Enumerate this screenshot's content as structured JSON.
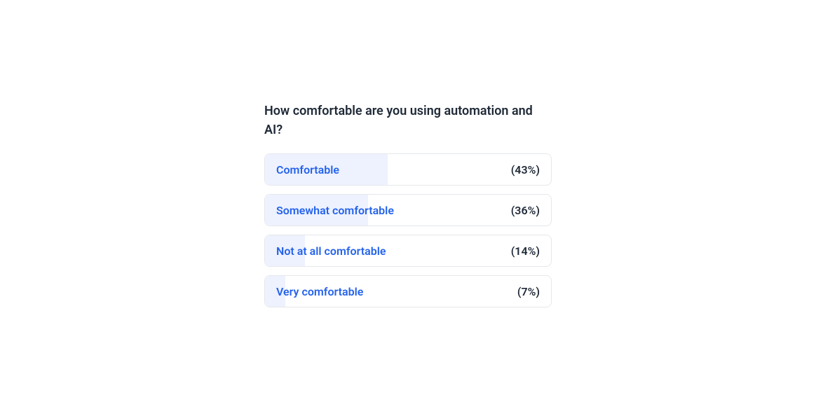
{
  "poll": {
    "question": "How comfortable are you using automation and AI?",
    "options": [
      {
        "label": "Comfortable",
        "percent_text": "(43%)",
        "bar_width": "43%"
      },
      {
        "label": "Somewhat comfortable",
        "percent_text": "(36%)",
        "bar_width": "36%"
      },
      {
        "label": "Not at all comfortable",
        "percent_text": "(14%)",
        "bar_width": "14%"
      },
      {
        "label": "Very comfortable",
        "percent_text": "(7%)",
        "bar_width": "7%"
      }
    ]
  },
  "chart_data": {
    "type": "bar",
    "title": "How comfortable are you using automation and AI?",
    "categories": [
      "Comfortable",
      "Somewhat comfortable",
      "Not at all comfortable",
      "Very comfortable"
    ],
    "values": [
      43,
      36,
      14,
      7
    ],
    "xlabel": "",
    "ylabel": "Percent",
    "ylim": [
      0,
      100
    ]
  }
}
